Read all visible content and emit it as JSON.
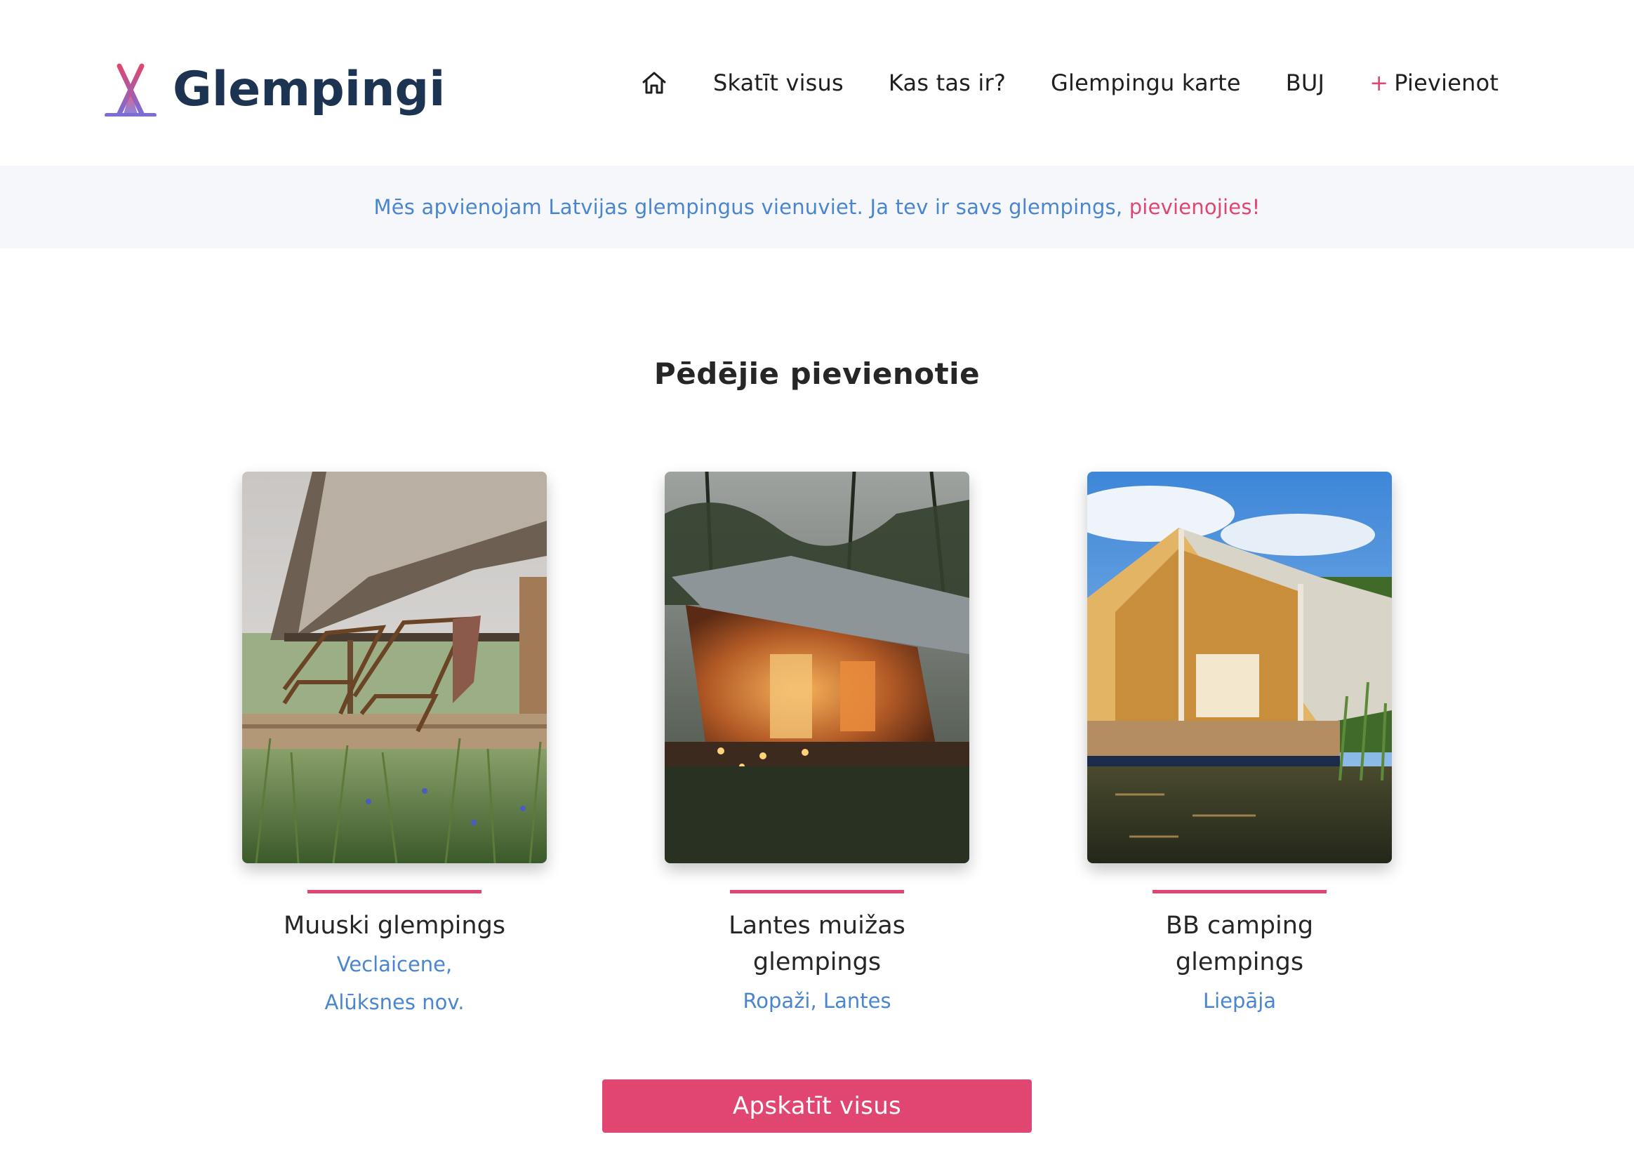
{
  "brand": {
    "name": "Glempingi",
    "logo_colors": {
      "top": "#e0466f",
      "bottom": "#7a6dd6",
      "text": "#1d3352",
      "dot": "#4a86cf"
    }
  },
  "nav": {
    "home_icon": "home-icon",
    "items": [
      {
        "label": "Skatīt visus"
      },
      {
        "label": "Kas tas ir?"
      },
      {
        "label": "Glempingu karte"
      },
      {
        "label": "BUJ"
      }
    ],
    "add": {
      "plus": "+",
      "label": "Pievienot"
    }
  },
  "banner": {
    "text": "Mēs apvienojam Latvijas glempingus vienuviet. Ja tev ir savs glempings, ",
    "link": "pievienojies!"
  },
  "section": {
    "title": "Pēdējie pievienotie"
  },
  "cards": [
    {
      "title": "Muuski glempings",
      "location": "Veclaicene, Alūksnes nov."
    },
    {
      "title": "Lantes muižas glempings",
      "location": "Ropaži, Lantes"
    },
    {
      "title": "BB camping glempings",
      "location": "Liepāja"
    }
  ],
  "cta": {
    "label": "Apskatīt visus"
  },
  "colors": {
    "accent": "#e0466f",
    "link_blue": "#4a86cf",
    "banner_bg": "#f6f7fa",
    "heading": "#262626"
  }
}
